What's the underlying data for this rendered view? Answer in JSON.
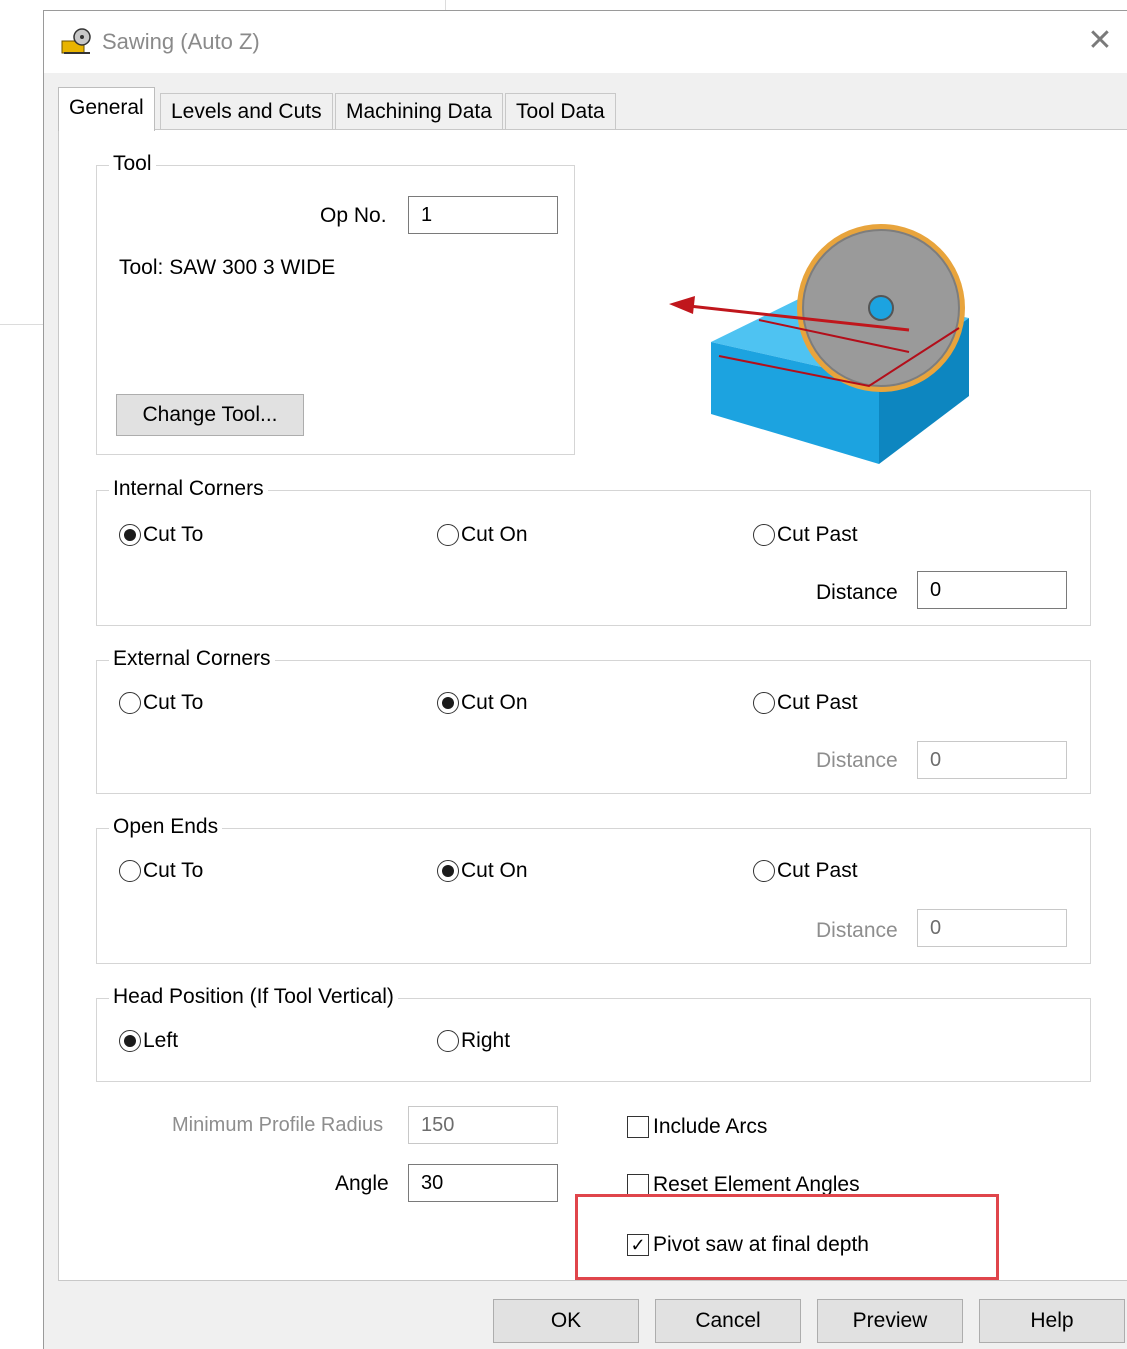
{
  "window": {
    "title": "Sawing (Auto Z)",
    "close_glyph": "✕"
  },
  "tabs": [
    {
      "label": "General",
      "active": true
    },
    {
      "label": "Levels and Cuts",
      "active": false
    },
    {
      "label": "Machining Data",
      "active": false
    },
    {
      "label": "Tool Data",
      "active": false
    }
  ],
  "tool_group": {
    "label": "Tool",
    "op_no_label": "Op No.",
    "op_no_value": "1",
    "tool_text": "Tool: SAW 300 3 WIDE",
    "change_tool_label": "Change Tool..."
  },
  "internal_corners": {
    "label": "Internal Corners",
    "options": [
      "Cut To",
      "Cut On",
      "Cut Past"
    ],
    "selected": "Cut To",
    "distance_label": "Distance",
    "distance_value": "0",
    "distance_enabled": true
  },
  "external_corners": {
    "label": "External Corners",
    "options": [
      "Cut To",
      "Cut On",
      "Cut Past"
    ],
    "selected": "Cut On",
    "distance_label": "Distance",
    "distance_value": "0",
    "distance_enabled": false
  },
  "open_ends": {
    "label": "Open Ends",
    "options": [
      "Cut To",
      "Cut On",
      "Cut Past"
    ],
    "selected": "Cut On",
    "distance_label": "Distance",
    "distance_value": "0",
    "distance_enabled": false
  },
  "head_position": {
    "label": "Head Position (If Tool Vertical)",
    "options": [
      "Left",
      "Right"
    ],
    "selected": "Left"
  },
  "min_profile_radius": {
    "label": "Minimum Profile Radius",
    "value": "150",
    "enabled": false
  },
  "angle": {
    "label": "Angle",
    "value": "30"
  },
  "checkboxes": {
    "include_arcs": {
      "label": "Include Arcs",
      "checked": false
    },
    "reset_element_angles": {
      "label": "Reset Element Angles",
      "checked": false
    },
    "pivot_saw": {
      "label": "Pivot saw at final depth",
      "checked": true
    }
  },
  "buttons": {
    "ok": "OK",
    "cancel": "Cancel",
    "preview": "Preview",
    "help": "Help"
  },
  "colors": {
    "highlight": "#e0454b",
    "block": "#1ca3e0",
    "blade": "#9a9a9a",
    "arrow": "#c0161c"
  }
}
